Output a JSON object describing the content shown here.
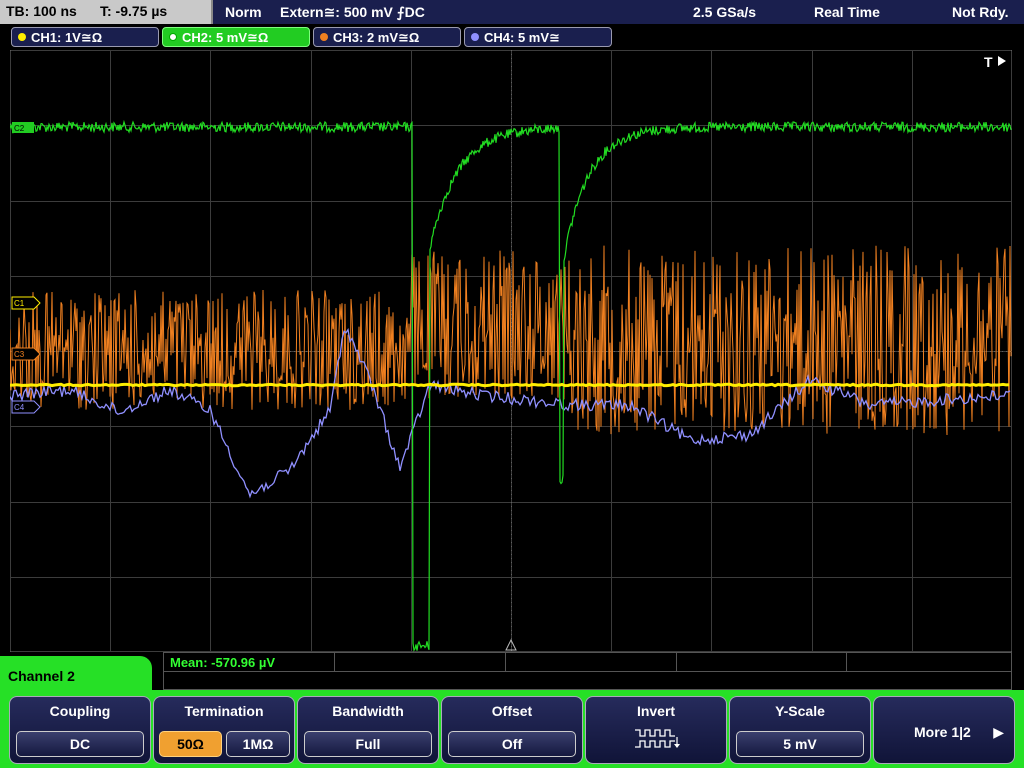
{
  "status": {
    "tb": "TB: 100 ns",
    "t": "T: -9.75 µs",
    "mode": "Norm",
    "trigger": "Extern≅: 500 mV ⨍DC",
    "sample_rate": "2.5 GSa/s",
    "acq": "Real Time",
    "state": "Not Rdy."
  },
  "channels": [
    {
      "label": "CH1: 1V≅Ω",
      "color": "#ffee00",
      "active": false
    },
    {
      "label": "CH2: 5 mV≅Ω",
      "color": "#22cc22",
      "active": true
    },
    {
      "label": "CH3: 2 mV≅Ω",
      "color": "#f08020",
      "active": false
    },
    {
      "label": "CH4: 5 mV≅",
      "color": "#9090ff",
      "active": false
    }
  ],
  "markers": {
    "c2": "C2",
    "c1": "C1",
    "c3": "C3",
    "c4": "C4",
    "trigger": "T"
  },
  "measurement": {
    "mean": "Mean: -570.96 µV"
  },
  "channel_label": "Channel 2",
  "menu": {
    "coupling": {
      "title": "Coupling",
      "value": "DC"
    },
    "termination": {
      "title": "Termination",
      "opt1": "50Ω",
      "opt2": "1MΩ",
      "selected": "50Ω"
    },
    "bandwidth": {
      "title": "Bandwidth",
      "value": "Full"
    },
    "offset": {
      "title": "Offset",
      "value": "Off"
    },
    "invert": {
      "title": "Invert",
      "icon": "invert-waveform-icon"
    },
    "yscale": {
      "title": "Y-Scale",
      "value": "5 mV"
    },
    "more": {
      "label": "More 1|2",
      "icon": "right-arrow-icon"
    }
  },
  "colors": {
    "ch1": "#ffee00",
    "ch2": "#22cc22",
    "ch3": "#f08020",
    "ch4": "#9090ff",
    "grid": "#3c3c3c",
    "menu_bg": "#26e026"
  }
}
